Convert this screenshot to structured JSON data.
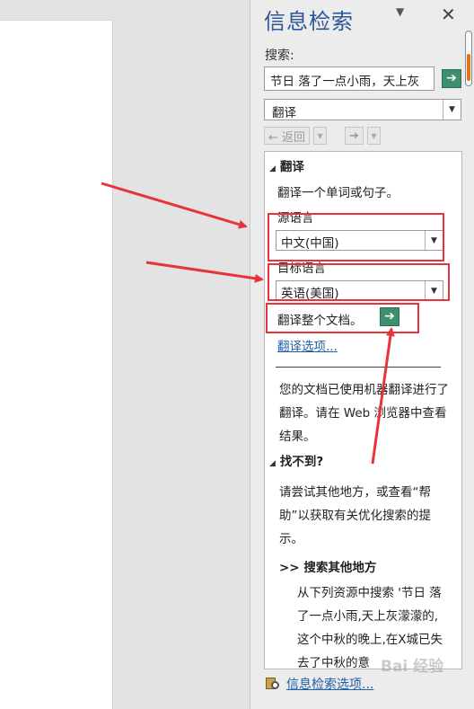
{
  "pane": {
    "title": "信息检索",
    "menu_glyph": "▼",
    "close_glyph": "✕"
  },
  "search": {
    "label": "搜索:",
    "value": "节日 落了一点小雨，天上灰",
    "go_glyph": "➔"
  },
  "service_select": {
    "value": "翻译"
  },
  "nav": {
    "back_label": "← 返回",
    "forward_glyph": "➔"
  },
  "results": {
    "translate": {
      "header": "翻译",
      "description": "翻译一个单词或句子。",
      "source_label": "源语言",
      "source_value": "中文(中国)",
      "target_label": "目标语言",
      "target_value": "英语(美国)",
      "doc_label": "翻译整个文档。",
      "options_link": "翻译选项..."
    },
    "notice": "您的文档已使用机器翻译进行了翻译。请在 Web 浏览器中查看结果。",
    "not_found": {
      "header": "找不到?",
      "text": "请尝试其他地方，或查看“帮助”以获取有关优化搜索的提示。",
      "search_other": ">> 搜索其他地方",
      "from_list": "从下列资源中搜索 '节日 落了一点小雨,天上灰濛濛的,这个中秋的晚上,在X城已失去了中秋的意"
    }
  },
  "footer": {
    "options_link": "信息检索选项..."
  },
  "watermark": "Bai 经验",
  "colors": {
    "title": "#2b579a",
    "link": "#1f5fa8",
    "go_button": "#3e8f6e",
    "highlight": "#e8333a",
    "scroll_accent": "#e0731c"
  }
}
